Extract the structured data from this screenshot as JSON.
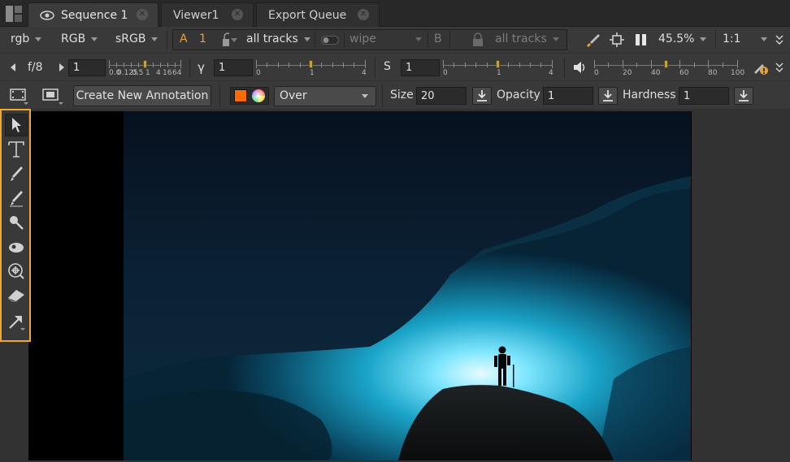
{
  "tabs": [
    {
      "label": "Sequence 1",
      "active": true
    },
    {
      "label": "Viewer1",
      "active": false
    },
    {
      "label": "Export Queue",
      "active": false
    }
  ],
  "row1": {
    "channels": "rgb",
    "layer": "RGB",
    "lut": "sRGB",
    "a_label": "A",
    "a_index": "1",
    "a_tracks": "all tracks",
    "wipe": "wipe",
    "b_label": "B",
    "b_tracks": "all tracks",
    "zoom": "45.5%",
    "ratio": "1:1"
  },
  "row2": {
    "fstop": "f/8",
    "gain_value": "1",
    "gain_ticks": [
      "0.0",
      "0.125",
      "0.5",
      "1",
      "4",
      "16",
      "64"
    ],
    "gamma_label": "γ",
    "gamma_value": "1",
    "gamma_ticks": [
      "0",
      "1",
      "4"
    ],
    "sat_label": "S",
    "sat_value": "1",
    "sat_ticks": [
      "0",
      "1",
      "4"
    ],
    "vol_ticks": [
      "0",
      "20",
      "40",
      "60",
      "80",
      "100"
    ]
  },
  "row3": {
    "create_annotation": "Create New Annotation",
    "blend_mode": "Over",
    "size_label": "Size",
    "size_value": "20",
    "opacity_label": "Opacity",
    "opacity_value": "1",
    "hardness_label": "Hardness",
    "hardness_value": "1",
    "brush_color": "#ff6a00"
  },
  "colors": {
    "highlight": "#f0a830",
    "handle": "#c8a23c"
  }
}
